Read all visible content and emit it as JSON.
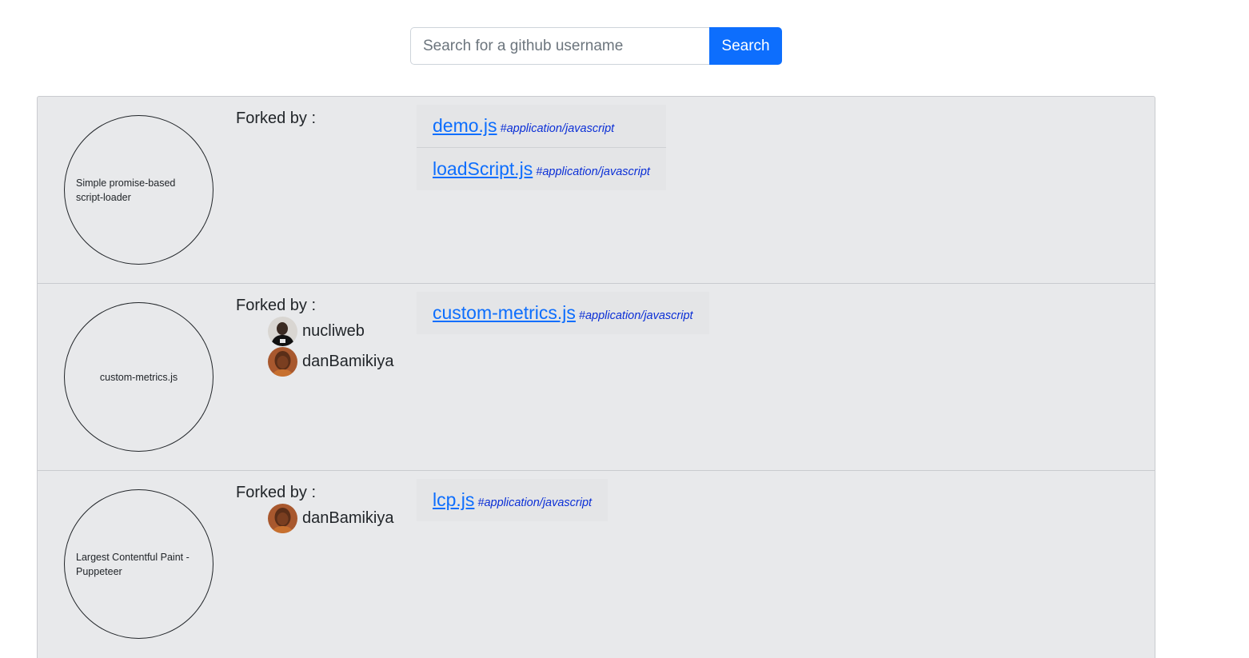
{
  "search": {
    "placeholder": "Search for a github username",
    "button_label": "Search"
  },
  "forked_by_label": "Forked by :",
  "gists": [
    {
      "description": "Simple promise-based script-loader",
      "forkers": [],
      "files": [
        {
          "name": "demo.js",
          "type": "#application/javascript"
        },
        {
          "name": "loadScript.js",
          "type": "#application/javascript"
        }
      ]
    },
    {
      "description": "custom-metrics.js",
      "forkers": [
        {
          "username": "nucliweb",
          "avatar_icon": "avatar-photo"
        },
        {
          "username": "danBamikiya",
          "avatar_icon": "avatar-photo"
        }
      ],
      "files": [
        {
          "name": "custom-metrics.js",
          "type": "#application/javascript"
        }
      ]
    },
    {
      "description": "Largest Contentful Paint - Puppeteer",
      "forkers": [
        {
          "username": "danBamikiya",
          "avatar_icon": "avatar-photo"
        }
      ],
      "files": [
        {
          "name": "lcp.js",
          "type": "#application/javascript"
        }
      ]
    }
  ],
  "colors": {
    "accent": "#0d6efd",
    "panel_bg": "#e8e9eb",
    "file_type": "#0b2fd6"
  }
}
